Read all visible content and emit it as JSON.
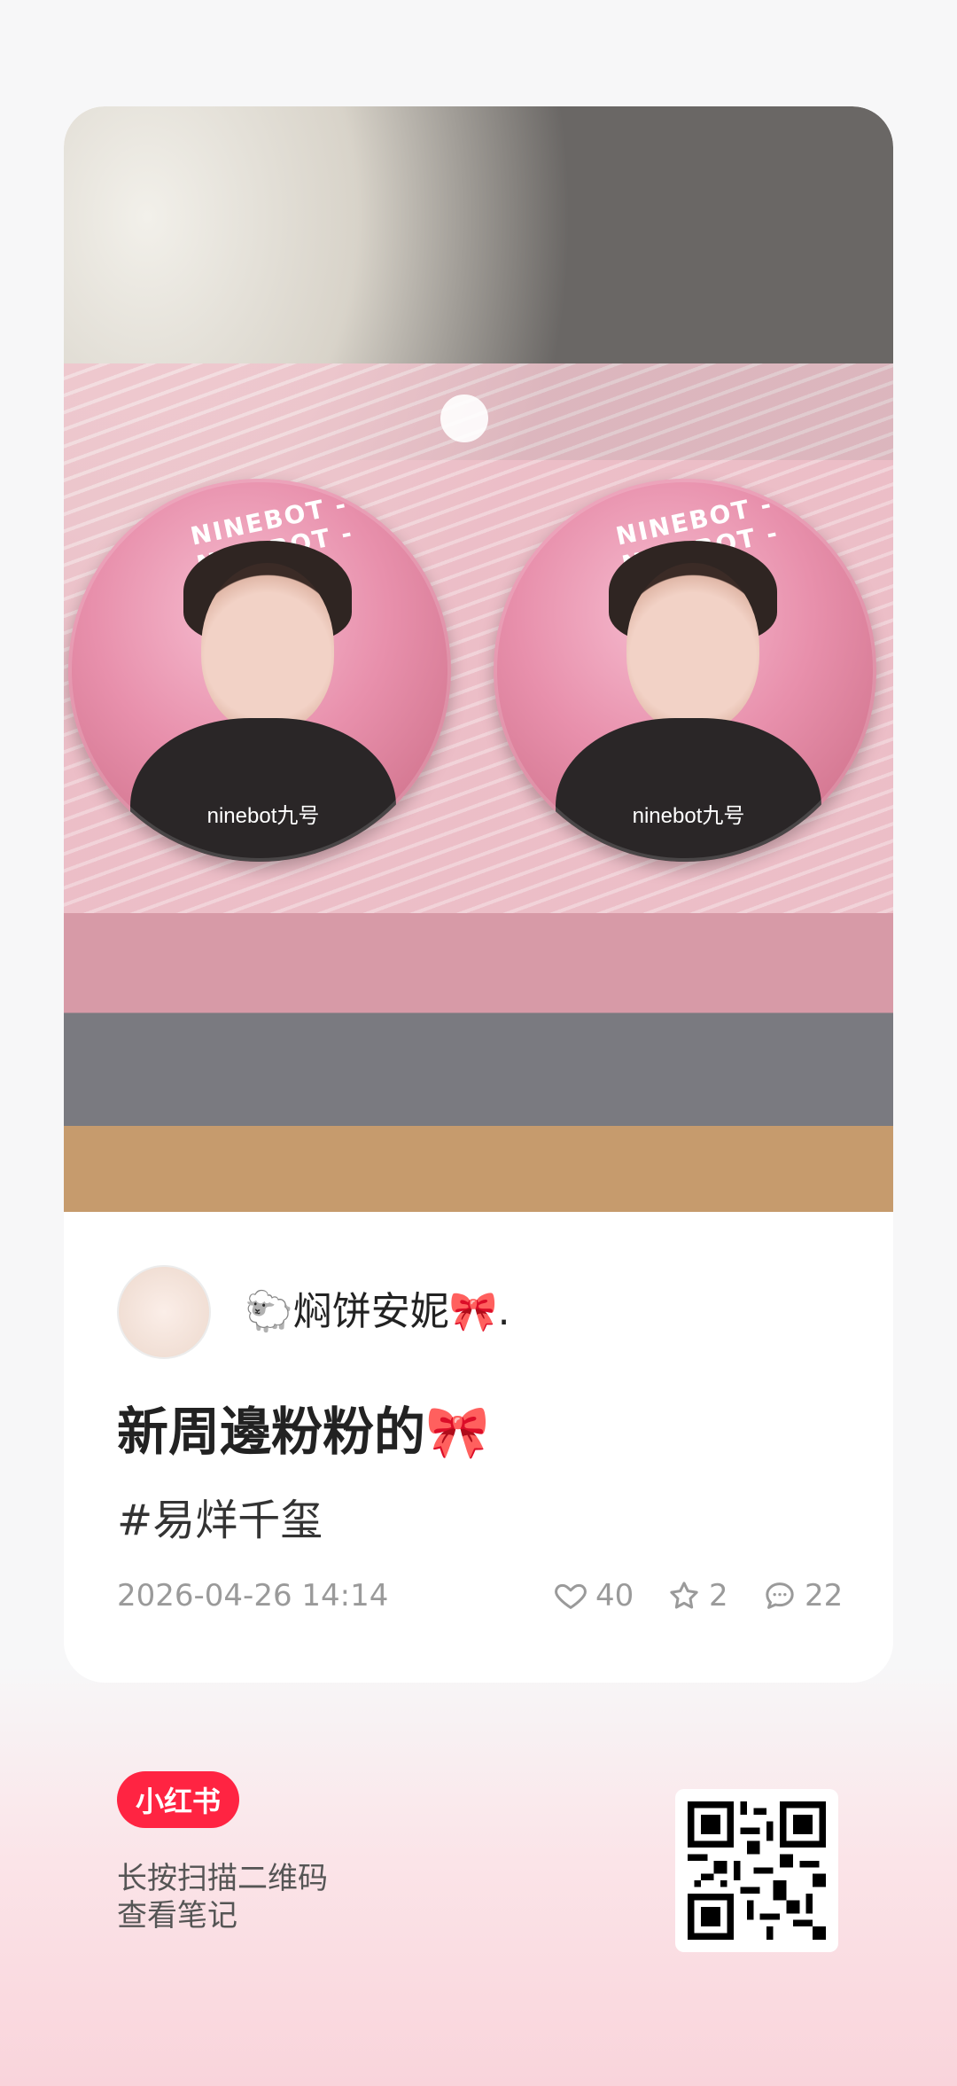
{
  "note": {
    "author": "🐑焖饼安妮🎀.",
    "title": "新周邊粉粉的🎀",
    "tag": "#易烊千玺",
    "timestamp": "2026-04-26 14:14",
    "likes": "40",
    "collects": "2",
    "comments": "22"
  },
  "image": {
    "badge_ring_text": "NINEBOT - NINEBOT -",
    "badge_brand_text": "ninebot九号"
  },
  "footer": {
    "brand": "小红书",
    "line1": "长按扫描二维码",
    "line2": "查看笔记"
  },
  "colors": {
    "brand_red": "#ff2442",
    "text_primary": "#222222",
    "text_secondary": "#9a9a9a"
  },
  "icons": [
    "heart-icon",
    "star-icon",
    "comment-icon",
    "qr-code"
  ]
}
